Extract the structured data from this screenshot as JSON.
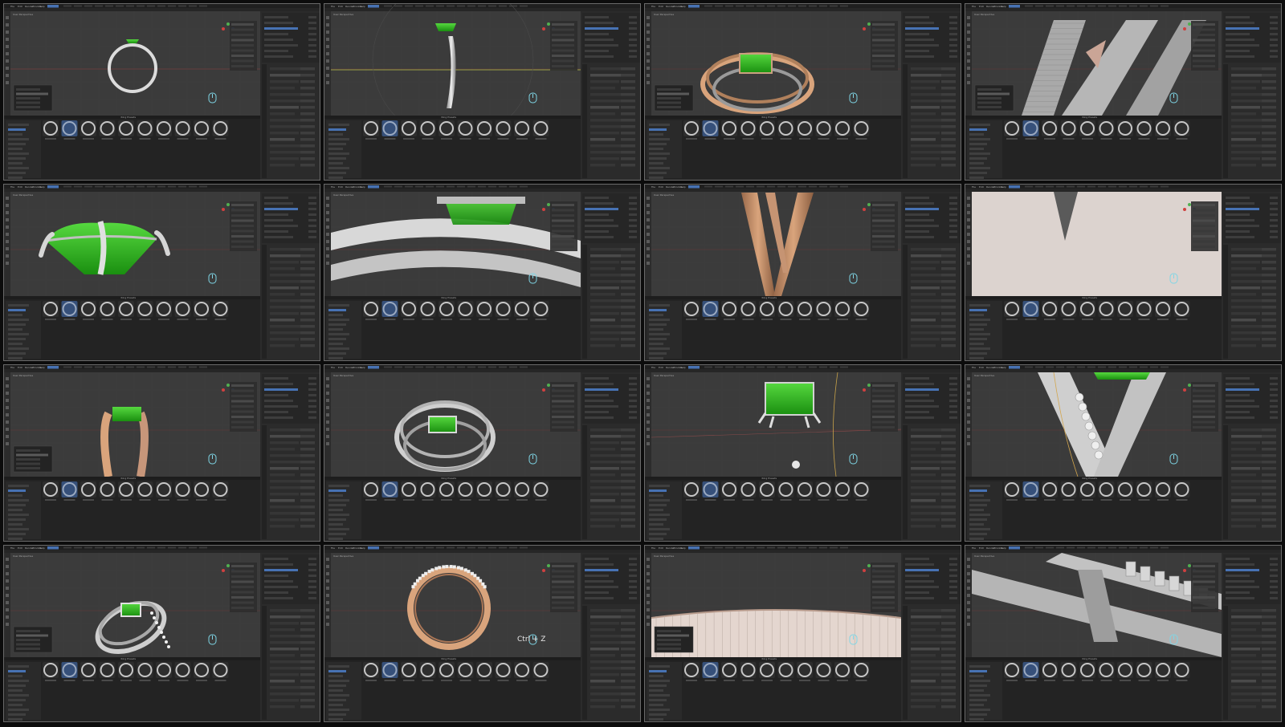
{
  "title": "",
  "colors": {
    "background": "#0c0c0c",
    "viewport": "#3b3b3b",
    "panel": "#2b2b2b",
    "header": "#1f1f1f",
    "selection": "#4772b3",
    "gold": "#d9a47c",
    "silver": "#c9c9c9",
    "gem": "#2fbf1f",
    "cursor_icon": "#7fd6e6"
  },
  "toolbar": {
    "menu_items": [
      "File",
      "Edit",
      "Render",
      "Window",
      "Help"
    ],
    "active_tab": "Layout"
  },
  "asset_browser": {
    "heading": "Ring Presets",
    "thumbnail_count": 10
  },
  "frames": [
    {
      "id": 1,
      "scene": "ring-circle",
      "side_menu_open": true,
      "caption": ""
    },
    {
      "id": 2,
      "scene": "ring-profile",
      "side_menu_open": false,
      "caption": ""
    },
    {
      "id": 3,
      "scene": "split-shank-gold",
      "side_menu_open": true,
      "caption": ""
    },
    {
      "id": 4,
      "scene": "shank-mesh-closeup",
      "side_menu_open": true,
      "caption": ""
    },
    {
      "id": 5,
      "scene": "gem-with-prongs",
      "side_menu_open": false,
      "caption": ""
    },
    {
      "id": 6,
      "scene": "bands-topdown",
      "side_menu_open": false,
      "caption": ""
    },
    {
      "id": 7,
      "scene": "v-split-gold",
      "side_menu_open": false,
      "caption": ""
    },
    {
      "id": 8,
      "scene": "v-closeup-flat",
      "side_menu_open": false,
      "caption": ""
    },
    {
      "id": 9,
      "scene": "gold-side-view",
      "side_menu_open": true,
      "caption": ""
    },
    {
      "id": 10,
      "scene": "silver-ring-full",
      "side_menu_open": false,
      "caption": ""
    },
    {
      "id": 11,
      "scene": "gem-prongs-floor",
      "side_menu_open": false,
      "caption": ""
    },
    {
      "id": 12,
      "scene": "v-with-stones",
      "side_menu_open": false,
      "caption": ""
    },
    {
      "id": 13,
      "scene": "silver-pave-ring",
      "side_menu_open": true,
      "caption": ""
    },
    {
      "id": 14,
      "scene": "gold-ring-pave-edge",
      "side_menu_open": false,
      "caption": "Ctrl + Z"
    },
    {
      "id": 15,
      "scene": "band-closeup",
      "side_menu_open": true,
      "caption": ""
    },
    {
      "id": 16,
      "scene": "bands-stones-closeup",
      "side_menu_open": false,
      "caption": ""
    }
  ]
}
